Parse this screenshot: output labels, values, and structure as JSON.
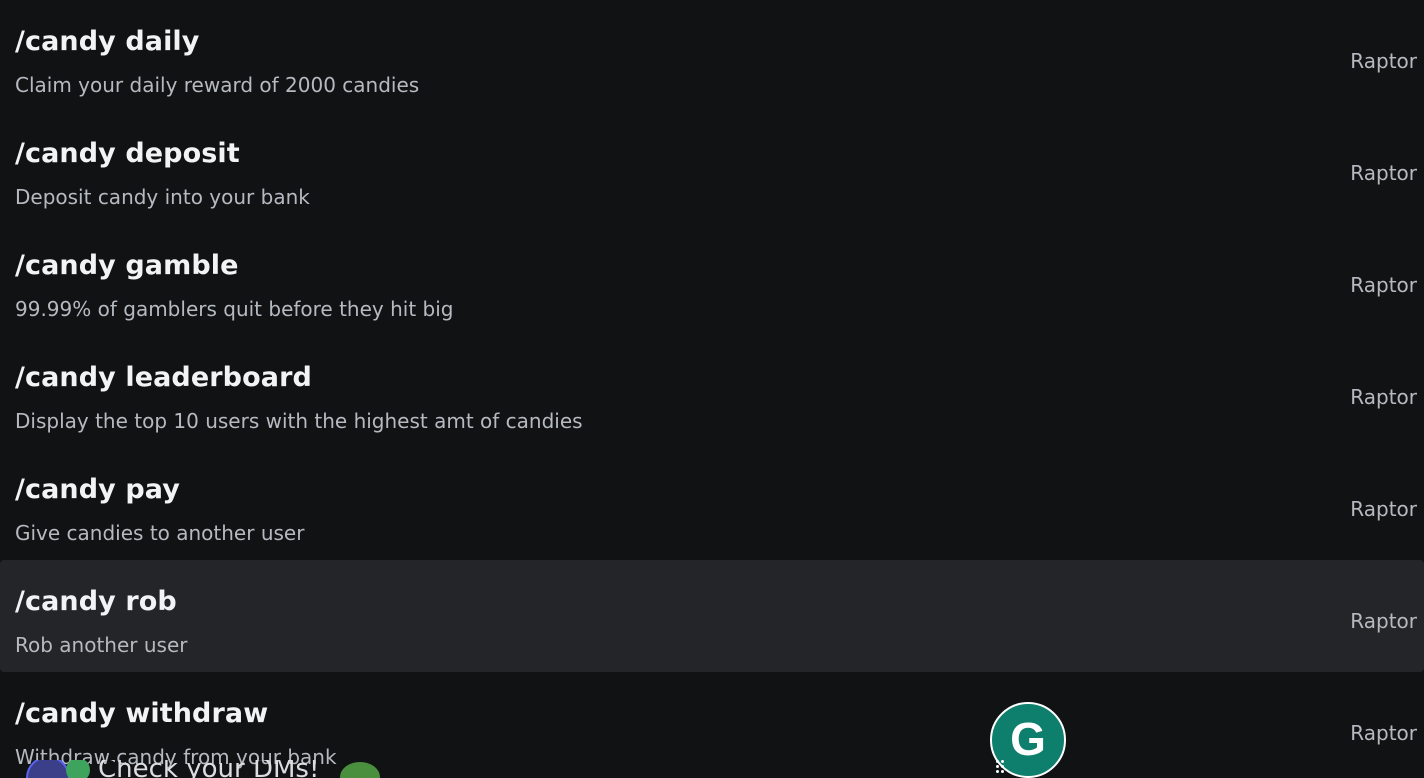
{
  "commands": [
    {
      "name": "/candy daily",
      "description": "Claim your daily reward of 2000 candies",
      "source": "Raptor",
      "selected": false
    },
    {
      "name": "/candy deposit",
      "description": "Deposit candy into your bank",
      "source": "Raptor",
      "selected": false
    },
    {
      "name": "/candy gamble",
      "description": "99.99% of gamblers quit before they hit big",
      "source": "Raptor",
      "selected": false
    },
    {
      "name": "/candy leaderboard",
      "description": "Display the top 10 users with the highest amt of candies",
      "source": "Raptor",
      "selected": false
    },
    {
      "name": "/candy pay",
      "description": "Give candies to another user",
      "source": "Raptor",
      "selected": false
    },
    {
      "name": "/candy rob",
      "description": "Rob another user",
      "source": "Raptor",
      "selected": true
    },
    {
      "name": "/candy withdraw",
      "description": "Withdraw candy from your bank",
      "source": "Raptor",
      "selected": false
    }
  ],
  "background": {
    "message_text": "Check your DMs!"
  },
  "grammarly": {
    "letter": "G"
  },
  "colors": {
    "background": "#111214",
    "selected_row": "#242528",
    "primary_text": "#f2f3f5",
    "secondary_text": "#b5bac1",
    "grammarly_green": "#0f7f6d"
  }
}
